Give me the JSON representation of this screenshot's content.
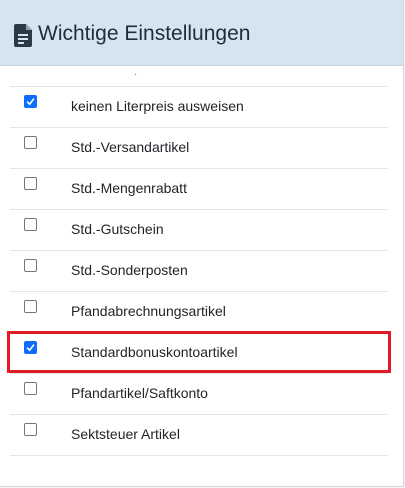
{
  "header": {
    "title": "Wichtige Einstellungen",
    "icon": "document-settings-icon",
    "background": "#d5e4ee"
  },
  "colors": {
    "accent": "#0d6efd",
    "highlight": "#e01b24"
  },
  "items": [
    {
      "label": "keinen Literpreis ausweisen",
      "checked": true
    },
    {
      "label": "Std.-Versandartikel",
      "checked": false
    },
    {
      "label": "Std.-Mengenrabatt",
      "checked": false
    },
    {
      "label": "Std.-Gutschein",
      "checked": false
    },
    {
      "label": "Std.-Sonderposten",
      "checked": false
    },
    {
      "label": "Pfandabrechnungsartikel",
      "checked": false
    },
    {
      "label": "Standardbonuskontoartikel",
      "checked": true,
      "highlighted": true
    },
    {
      "label": "Pfandartikel/Saftkonto",
      "checked": false
    },
    {
      "label": "Sektsteuer Artikel",
      "checked": false
    }
  ]
}
